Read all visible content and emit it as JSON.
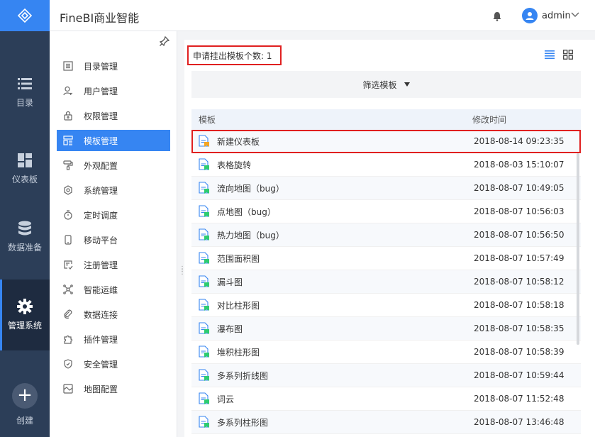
{
  "header": {
    "title": "FineBI商业智能",
    "user": "admin",
    "icons": [
      "bell-icon",
      "avatar-icon",
      "chevron-down-icon"
    ]
  },
  "rail": {
    "items": [
      {
        "label": "目录",
        "icon": "list-icon"
      },
      {
        "label": "仪表板",
        "icon": "dashboard-icon"
      },
      {
        "label": "数据准备",
        "icon": "database-icon"
      },
      {
        "label": "管理系统",
        "icon": "gear-icon"
      }
    ],
    "create_label": "创建"
  },
  "subnav": {
    "items": [
      {
        "label": "目录管理",
        "icon": "catalog-icon"
      },
      {
        "label": "用户管理",
        "icon": "user-icon"
      },
      {
        "label": "权限管理",
        "icon": "lock-icon"
      },
      {
        "label": "模板管理",
        "icon": "template-icon"
      },
      {
        "label": "外观配置",
        "icon": "brush-icon"
      },
      {
        "label": "系统管理",
        "icon": "settings-icon"
      },
      {
        "label": "定时调度",
        "icon": "timer-icon"
      },
      {
        "label": "移动平台",
        "icon": "mobile-icon"
      },
      {
        "label": "注册管理",
        "icon": "register-icon"
      },
      {
        "label": "智能运维",
        "icon": "ops-icon"
      },
      {
        "label": "数据连接",
        "icon": "link-icon"
      },
      {
        "label": "插件管理",
        "icon": "plugin-icon"
      },
      {
        "label": "安全管理",
        "icon": "shield-icon"
      },
      {
        "label": "地图配置",
        "icon": "map-icon"
      }
    ],
    "active_index": 3
  },
  "main": {
    "count_text": "申请挂出模板个数: 1",
    "filter_label": "筛选模板",
    "columns": {
      "name": "模板",
      "time": "修改时间"
    },
    "rows": [
      {
        "name": "新建仪表板",
        "time": "2018-08-14 09:23:35",
        "highlight": true,
        "badge_color": "#f5a623"
      },
      {
        "name": "表格旋转",
        "time": "2018-08-03 15:10:07",
        "badge_color": "#2ecc71"
      },
      {
        "name": "流向地图（bug）",
        "time": "2018-08-07 10:49:05",
        "badge_color": "#2ecc71"
      },
      {
        "name": "点地图（bug）",
        "time": "2018-08-07 10:56:03",
        "badge_color": "#2ecc71"
      },
      {
        "name": "热力地图（bug）",
        "time": "2018-08-07 10:56:50",
        "badge_color": "#2ecc71"
      },
      {
        "name": "范围面积图",
        "time": "2018-08-07 10:57:49",
        "badge_color": "#2ecc71"
      },
      {
        "name": "漏斗图",
        "time": "2018-08-07 10:58:12",
        "badge_color": "#2ecc71"
      },
      {
        "name": "对比柱形图",
        "time": "2018-08-07 10:58:18",
        "badge_color": "#2ecc71"
      },
      {
        "name": "瀑布图",
        "time": "2018-08-07 10:58:35",
        "badge_color": "#2ecc71"
      },
      {
        "name": "堆积柱形图",
        "time": "2018-08-07 10:58:39",
        "badge_color": "#2ecc71"
      },
      {
        "name": "多系列折线图",
        "time": "2018-08-07 10:59:44",
        "badge_color": "#2ecc71"
      },
      {
        "name": "词云",
        "time": "2018-08-07 11:52:48",
        "badge_color": "#2ecc71"
      },
      {
        "name": "多系列柱形图",
        "time": "2018-08-07 13:46:48",
        "badge_color": "#2ecc71"
      }
    ]
  },
  "colors": {
    "accent": "#3685f2",
    "rail_bg": "#2c3e58",
    "highlight_border": "#e02020"
  }
}
